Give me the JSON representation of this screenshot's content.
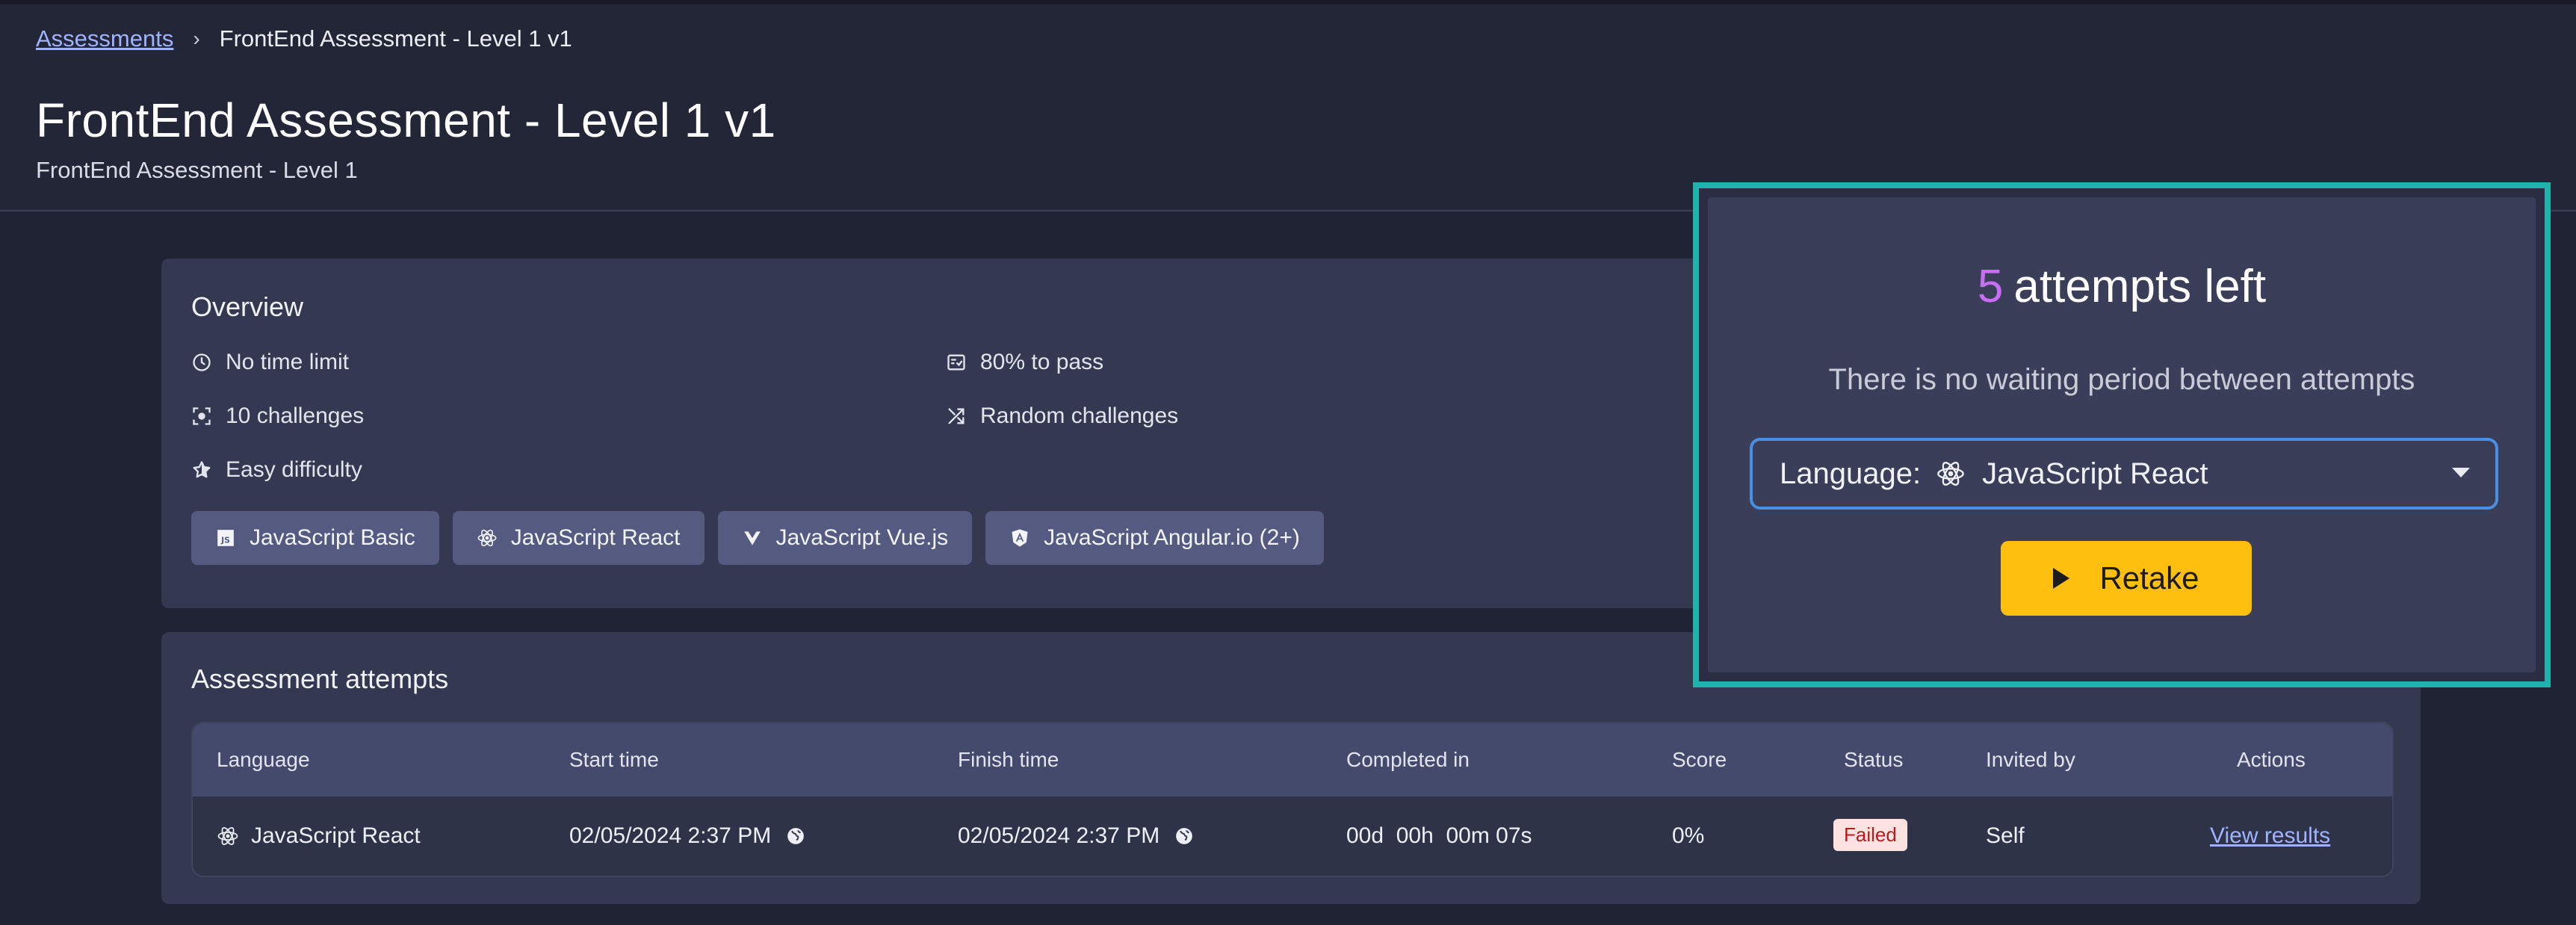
{
  "breadcrumb": {
    "root": "Assessments",
    "separator": "›",
    "current": "FrontEnd Assessment - Level 1 v1"
  },
  "page": {
    "title": "FrontEnd Assessment - Level 1 v1",
    "subtitle": "FrontEnd Assessment - Level 1"
  },
  "overview": {
    "title": "Overview",
    "features": [
      {
        "icon": "clock-icon",
        "label": "No time limit"
      },
      {
        "icon": "challenges-icon",
        "label": "10 challenges"
      },
      {
        "icon": "star-icon",
        "label": "Easy difficulty"
      },
      {
        "icon": "pass-icon",
        "label": "80% to pass"
      },
      {
        "icon": "shuffle-icon",
        "label": "Random challenges"
      }
    ],
    "languages": [
      {
        "icon": "js-icon",
        "label": "JavaScript Basic"
      },
      {
        "icon": "react-icon",
        "label": "JavaScript React"
      },
      {
        "icon": "vue-icon",
        "label": "JavaScript Vue.js"
      },
      {
        "icon": "angular-icon",
        "label": "JavaScript Angular.io (2+)"
      }
    ]
  },
  "attempts": {
    "title": "Assessment attempts",
    "columns": [
      "Language",
      "Start time",
      "Finish time",
      "Completed in",
      "Score",
      "Status",
      "Invited by",
      "Actions"
    ],
    "rows": [
      {
        "language": "JavaScript React",
        "start": "02/05/2024 2:37 PM",
        "finish": "02/05/2024 2:37 PM",
        "completed": "00d  00h  00m 07s",
        "score": "0%",
        "status": "Failed",
        "invited_by": "Self",
        "action": "View results"
      }
    ]
  },
  "popover": {
    "attempts_count": "5",
    "attempts_label": "attempts left",
    "waiting_text": "There is no waiting period between attempts",
    "language_label": "Language:",
    "language_value": "JavaScript React",
    "retake_label": "Retake"
  },
  "colors": {
    "accent_purple": "#c86ef5",
    "retake_yellow": "#ffbf0f",
    "highlight_teal": "#1fb3ad",
    "select_border": "#4a90e2",
    "failed_bg": "#fde2e2",
    "failed_text": "#b71c1c"
  }
}
